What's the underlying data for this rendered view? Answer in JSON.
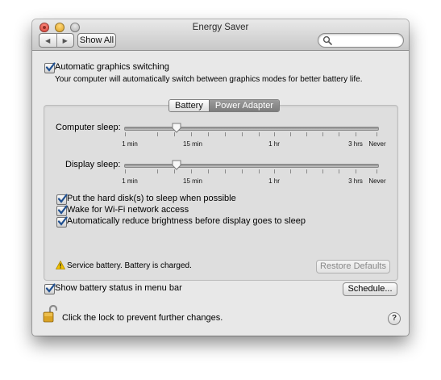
{
  "window": {
    "title": "Energy Saver"
  },
  "toolbar": {
    "back_glyph": "◀",
    "forward_glyph": "▶",
    "show_all_label": "Show All",
    "search": {
      "value": "",
      "placeholder": "",
      "icon": "search-icon"
    }
  },
  "graphics_switching": {
    "checked": true,
    "label": "Automatic graphics switching",
    "description": "Your computer will automatically switch between graphics modes for better battery life."
  },
  "tabs": [
    {
      "label": "Battery",
      "selected": false
    },
    {
      "label": "Power Adapter",
      "selected": true
    }
  ],
  "computer_sleep": {
    "label": "Computer sleep:",
    "value": "10 min",
    "ticks": [
      "1 min",
      "15 min",
      "1 hr",
      "3 hrs",
      "Never"
    ]
  },
  "display_sleep": {
    "label": "Display sleep:",
    "value": "10 min",
    "ticks": [
      "1 min",
      "15 min",
      "1 hr",
      "3 hrs",
      "Never"
    ]
  },
  "options": [
    {
      "label": "Put the hard disk(s) to sleep when possible",
      "checked": true
    },
    {
      "label": "Wake for Wi-Fi network access",
      "checked": true
    },
    {
      "label": "Automatically reduce brightness before display goes to sleep",
      "checked": true
    }
  ],
  "status": {
    "icon": "warning-icon",
    "text": "Service battery. Battery is charged."
  },
  "restore_defaults_label": "Restore Defaults",
  "show_battery_status": {
    "checked": true,
    "label": "Show battery status in menu bar"
  },
  "schedule_label": "Schedule...",
  "lock": {
    "icon": "lock-open-icon",
    "text": "Click the lock to prevent further changes."
  },
  "help_label": "?",
  "colors": {
    "window_bg": "#e8e8e8",
    "panel_bg": "#dedede",
    "checkmark": "#1f4f8f",
    "selected_tab": "#888888"
  }
}
